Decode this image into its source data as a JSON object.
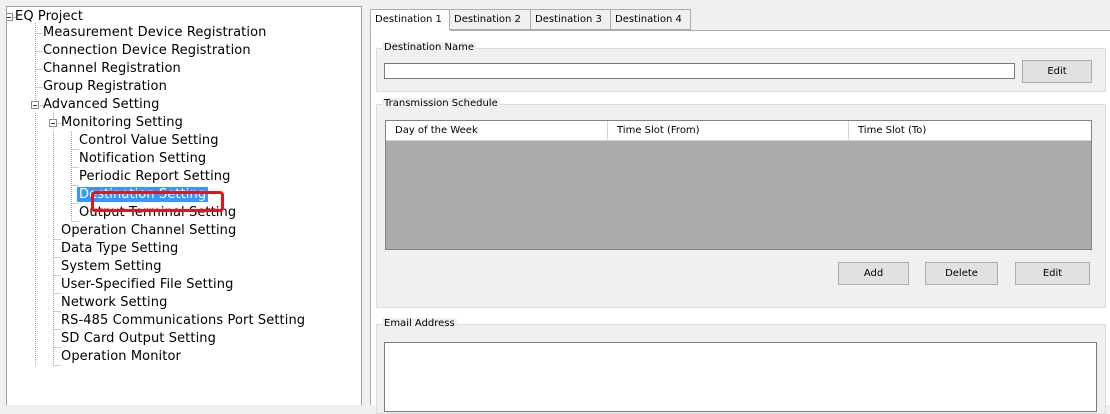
{
  "tree": {
    "root": "EQ Project",
    "items": [
      {
        "label": "Measurement Device Registration"
      },
      {
        "label": "Connection Device Registration"
      },
      {
        "label": "Channel Registration"
      },
      {
        "label": "Group Registration"
      },
      {
        "label": "Advanced Setting"
      },
      {
        "label": "Monitoring Setting"
      },
      {
        "label": "Control Value Setting"
      },
      {
        "label": "Notification Setting"
      },
      {
        "label": "Periodic Report Setting"
      },
      {
        "label": "Destination Setting",
        "selected": true
      },
      {
        "label": "Output Terminal Setting"
      },
      {
        "label": "Operation Channel Setting"
      },
      {
        "label": "Data Type Setting"
      },
      {
        "label": "System Setting"
      },
      {
        "label": "User-Specified File Setting"
      },
      {
        "label": "Network Setting"
      },
      {
        "label": "RS-485 Communications Port Setting"
      },
      {
        "label": "SD Card Output Setting"
      },
      {
        "label": "Operation Monitor"
      }
    ]
  },
  "tabs": [
    "Destination 1",
    "Destination 2",
    "Destination 3",
    "Destination 4"
  ],
  "destination_name": {
    "group_label": "Destination Name",
    "value": "",
    "edit_label": "Edit"
  },
  "schedule": {
    "group_label": "Transmission Schedule",
    "columns": [
      "Day of the Week",
      "Time Slot (From)",
      "Time Slot (To)"
    ],
    "add_label": "Add",
    "delete_label": "Delete",
    "edit_label": "Edit"
  },
  "email": {
    "group_label": "Email Address",
    "value": ""
  },
  "colors": {
    "selection": "#3399ff",
    "highlight_box": "#e3141c",
    "grid_background": "#ababab"
  }
}
